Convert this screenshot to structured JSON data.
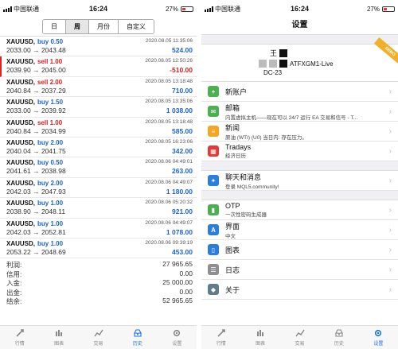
{
  "left": {
    "status": {
      "carrier": "中国联通",
      "time": "16:24",
      "battery": "27%"
    },
    "segments": [
      {
        "label": "日",
        "active": false
      },
      {
        "label": "周",
        "active": true
      },
      {
        "label": "月份",
        "active": false
      },
      {
        "label": "自定义",
        "active": false
      }
    ],
    "trades": [
      {
        "symbol": "XAUUSD,",
        "side": "buy",
        "vol": "buy 0.50",
        "date": "2020.08.05 11:35:06",
        "prices": "2033.00 → 2043.48",
        "pl": "524.00",
        "neg": false
      },
      {
        "symbol": "XAUUSD,",
        "side": "sell",
        "vol": "sell 1.00",
        "date": "2020.08.05 12:50:26",
        "prices": "2039.90 → 2045.00",
        "pl": "-510.00",
        "neg": true
      },
      {
        "symbol": "XAUUSD,",
        "side": "sell",
        "vol": "sell 2.00",
        "date": "2020.08.05 13:18:48",
        "prices": "2040.84 → 2037.29",
        "pl": "710.00",
        "neg": false
      },
      {
        "symbol": "XAUUSD,",
        "side": "buy",
        "vol": "buy 1.50",
        "date": "2020.08.05 13:35:06",
        "prices": "2033.00 → 2039.92",
        "pl": "1 038.00",
        "neg": false
      },
      {
        "symbol": "XAUUSD,",
        "side": "sell",
        "vol": "sell 1.00",
        "date": "2020.08.05 13:18:48",
        "prices": "2040.84 → 2034.99",
        "pl": "585.00",
        "neg": false
      },
      {
        "symbol": "XAUUSD,",
        "side": "buy",
        "vol": "buy 2.00",
        "date": "2020.08.05 16:23:06",
        "prices": "2040.04 → 2041.75",
        "pl": "342.00",
        "neg": false
      },
      {
        "symbol": "XAUUSD,",
        "side": "buy",
        "vol": "buy 0.50",
        "date": "2020.08.06 04:49:01",
        "prices": "2041.61 → 2038.98",
        "pl": "263.00",
        "neg": false
      },
      {
        "symbol": "XAUUSD,",
        "side": "buy",
        "vol": "buy 2.00",
        "date": "2020.08.06 04:49:07",
        "prices": "2042.03 → 2047.93",
        "pl": "1 180.00",
        "neg": false
      },
      {
        "symbol": "XAUUSD,",
        "side": "buy",
        "vol": "buy 1.00",
        "date": "2020.08.06 05:20:32",
        "prices": "2038.90 → 2048.11",
        "pl": "921.00",
        "neg": false
      },
      {
        "symbol": "XAUUSD,",
        "side": "buy",
        "vol": "buy 1.00",
        "date": "2020.08.06 04:49:07",
        "prices": "2042.03 → 2052.81",
        "pl": "1 078.00",
        "neg": false
      },
      {
        "symbol": "XAUUSD,",
        "side": "buy",
        "vol": "buy 1.00",
        "date": "2020.08.06 09:39:19",
        "prices": "2053.22 → 2048.69",
        "pl": "453.00",
        "neg": false
      }
    ],
    "summary": [
      {
        "label": "利润:",
        "value": "27 965.65"
      },
      {
        "label": "信用:",
        "value": "0.00"
      },
      {
        "label": "入金:",
        "value": "25 000.00"
      },
      {
        "label": "出金:",
        "value": "0.00"
      },
      {
        "label": "结余:",
        "value": "52 965.65"
      }
    ],
    "tabs": [
      {
        "label": "行情",
        "icon": "quotes-icon",
        "active": false
      },
      {
        "label": "图表",
        "icon": "chart-icon",
        "active": false
      },
      {
        "label": "交易",
        "icon": "trade-icon",
        "active": false
      },
      {
        "label": "历史",
        "icon": "history-icon",
        "active": true
      },
      {
        "label": "设置",
        "icon": "settings-icon",
        "active": false
      }
    ]
  },
  "right": {
    "status": {
      "carrier": "中国联通",
      "time": "16:24",
      "battery": "27%"
    },
    "title": "设置",
    "account": {
      "name": "王",
      "server": "ATFXGM1-Live",
      "server2": "DC-23",
      "ribbon": "DEMO"
    },
    "items_a": [
      {
        "label": "新账户",
        "sub": "",
        "icon": "new-account-icon",
        "color": "#4caf50",
        "glyph": "+"
      },
      {
        "label": "邮箱",
        "sub": "内置虚拟主机——现在可以 24/7 运行 EA 交易和信号 - T...",
        "icon": "mailbox-icon",
        "color": "#4caf50",
        "glyph": "✉"
      },
      {
        "label": "新闻",
        "sub": "原油 (WTI) (U0) 当日内: 存在压力。",
        "icon": "news-icon",
        "color": "#f5a623",
        "glyph": "≡"
      },
      {
        "label": "Tradays",
        "sub": "经济日历",
        "icon": "tradays-icon",
        "color": "#e53935",
        "glyph": "▦"
      }
    ],
    "items_b": [
      {
        "label": "聊天和消息",
        "sub": "登录 MQL5.community!",
        "icon": "chat-icon",
        "color": "#2a7de1",
        "glyph": "✦"
      }
    ],
    "items_c": [
      {
        "label": "OTP",
        "sub": "一次性密码生成器",
        "icon": "otp-icon",
        "color": "#4caf50",
        "glyph": "▮"
      },
      {
        "label": "界面",
        "sub": "中文",
        "icon": "interface-icon",
        "color": "#2a7de1",
        "glyph": "A"
      },
      {
        "label": "图表",
        "sub": "",
        "icon": "charts-icon",
        "color": "#2a7de1",
        "glyph": "▯"
      },
      {
        "label": "日志",
        "sub": "",
        "icon": "journal-icon",
        "color": "#8e8e93",
        "glyph": "☰"
      },
      {
        "label": "关于",
        "sub": "",
        "icon": "about-icon",
        "color": "#607d8b",
        "glyph": "◆"
      }
    ],
    "tabs": [
      {
        "label": "行情",
        "icon": "quotes-icon",
        "active": false
      },
      {
        "label": "图表",
        "icon": "chart-icon",
        "active": false
      },
      {
        "label": "交易",
        "icon": "trade-icon",
        "active": false
      },
      {
        "label": "历史",
        "icon": "history-icon",
        "active": false
      },
      {
        "label": "设置",
        "icon": "settings-icon",
        "active": true
      }
    ]
  }
}
